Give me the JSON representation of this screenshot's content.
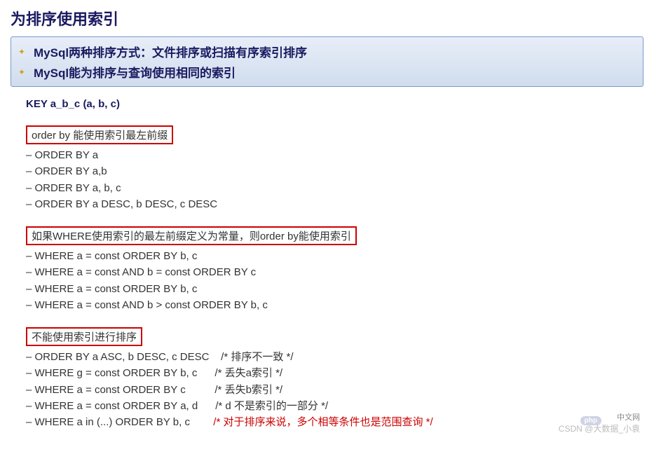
{
  "title": "为排序使用索引",
  "callout": {
    "items": [
      "MySql两种排序方式：文件排序或扫描有序索引排序",
      "MySql能为排序与查询使用相同的索引"
    ]
  },
  "key_def": "KEY a_b_c (a, b, c)",
  "sections": [
    {
      "header": "order by 能使用索引最左前缀",
      "lines": [
        {
          "text": "– ORDER BY a"
        },
        {
          "text": "– ORDER BY a,b"
        },
        {
          "text": "– ORDER BY a, b, c"
        },
        {
          "text": "– ORDER BY a DESC, b DESC, c DESC"
        }
      ]
    },
    {
      "header": "如果WHERE使用索引的最左前缀定义为常量，则order by能使用索引",
      "lines": [
        {
          "text": "– WHERE a = const ORDER BY b, c"
        },
        {
          "text": "– WHERE a = const AND b = const ORDER BY c"
        },
        {
          "text": "– WHERE a = const ORDER BY b, c"
        },
        {
          "text": "– WHERE a = const AND b > const ORDER BY b, c"
        }
      ]
    },
    {
      "header": "不能使用索引进行排序",
      "lines": [
        {
          "text": "– ORDER BY a ASC, b DESC, c DESC    ",
          "comment": "/* 排序不一致 */"
        },
        {
          "text": "– WHERE g = const ORDER BY b, c      ",
          "comment": "/* 丢失a索引 */"
        },
        {
          "text": "– WHERE a = const ORDER BY c          ",
          "comment": "/* 丢失b索引 */"
        },
        {
          "text": "– WHERE a = const ORDER BY a, d      ",
          "comment": "/* d 不是索引的一部分 */"
        },
        {
          "text": "– WHERE a in (...) ORDER BY b, c        ",
          "comment": "/* 对于排序来说，多个相等条件也是范围查询 */",
          "red": true
        }
      ]
    }
  ],
  "watermarks": {
    "php": "php",
    "cnnet": "中文网",
    "csdn": "CSDN @大数据_小袁"
  }
}
